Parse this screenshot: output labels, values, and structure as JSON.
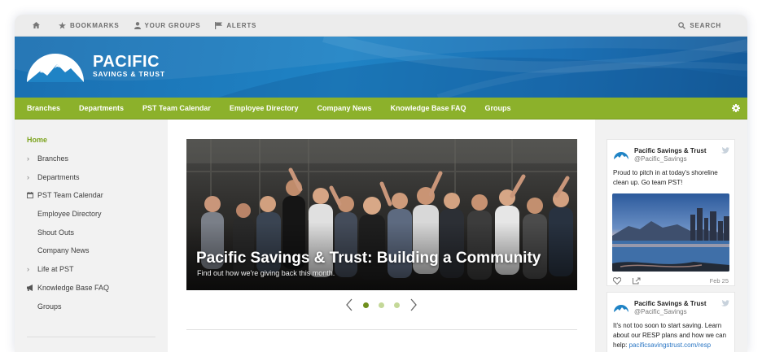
{
  "topbar": {
    "items": [
      {
        "label": "",
        "icon": "home-icon"
      },
      {
        "label": "BOOKMARKS",
        "icon": "star-icon"
      },
      {
        "label": "YOUR GROUPS",
        "icon": "user-icon"
      },
      {
        "label": "ALERTS",
        "icon": "flag-icon"
      }
    ],
    "search_label": "SEARCH"
  },
  "brand": {
    "name": "PACIFIC",
    "tagline": "SAVINGS & TRUST"
  },
  "nav": {
    "items": [
      "Branches",
      "Departments",
      "PST Team Calendar",
      "Employee Directory",
      "Company News",
      "Knowledge Base FAQ",
      "Groups"
    ]
  },
  "sidebar": {
    "items": [
      {
        "label": "Home",
        "lead": "none"
      },
      {
        "label": "Branches",
        "lead": "chevron-right-icon"
      },
      {
        "label": "Departments",
        "lead": "chevron-right-icon"
      },
      {
        "label": "PST Team Calendar",
        "lead": "calendar-icon"
      },
      {
        "label": "Employee Directory",
        "lead": "none"
      },
      {
        "label": "Shout Outs",
        "lead": "none"
      },
      {
        "label": "Company News",
        "lead": "none"
      },
      {
        "label": "Life at PST",
        "lead": "chevron-right-icon"
      },
      {
        "label": "Knowledge Base FAQ",
        "lead": "megaphone-icon"
      },
      {
        "label": "Groups",
        "lead": "none"
      }
    ]
  },
  "hero": {
    "title": "Pacific Savings & Trust: Building a Community",
    "subtitle": "Find out how we're giving back this month.",
    "slide_count": 3,
    "active_slide": 1
  },
  "tweets": [
    {
      "name": "Pacific Savings & Trust",
      "handle": "@Pacific_Savings",
      "text": "Proud to pitch in at today's shoreline clean up. Go team PST!",
      "date": "Feb 25"
    },
    {
      "name": "Pacific Savings & Trust",
      "handle": "@Pacific_Savings",
      "text": "It's not too soon to start saving. Learn about our RESP plans and how we can help:",
      "link": "pacificsavingstrust.com/resp"
    }
  ],
  "colors": {
    "nav_green": "#8cb12b",
    "banner_blue": "#1f83c5",
    "home_green": "#7ca31d",
    "dot_active": "#6f8f1d",
    "dot_inactive": "#c4d898",
    "link_blue": "#2a76c4"
  }
}
